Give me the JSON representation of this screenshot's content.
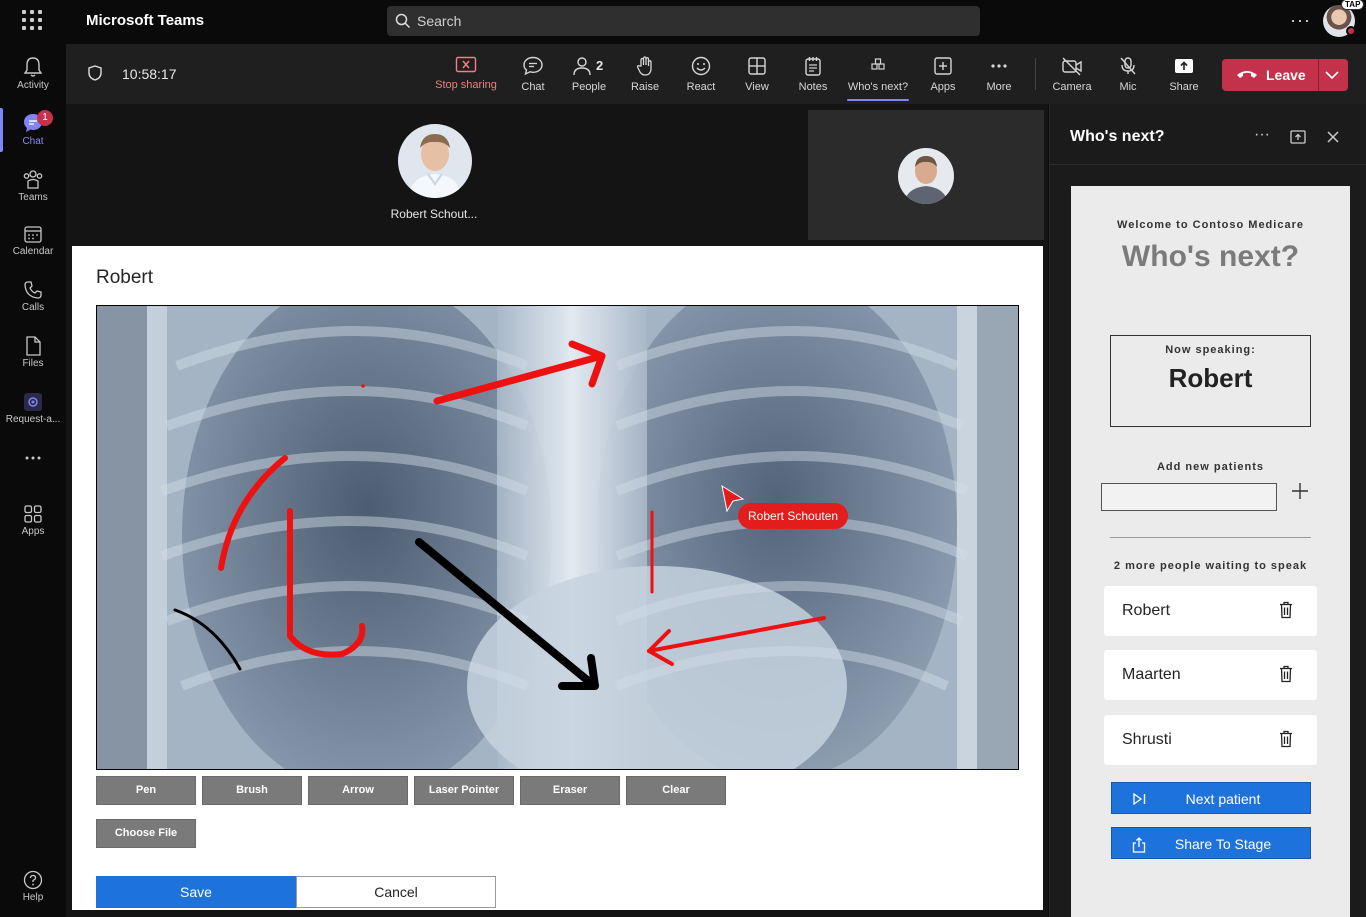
{
  "app": {
    "title": "Microsoft Teams"
  },
  "search": {
    "placeholder": "Search"
  },
  "user": {
    "initials_badge": "TAP"
  },
  "rail": {
    "items": [
      {
        "label": "Activity",
        "icon": "bell-icon"
      },
      {
        "label": "Chat",
        "icon": "chat-icon",
        "badge": "1",
        "active": true
      },
      {
        "label": "Teams",
        "icon": "teams-icon"
      },
      {
        "label": "Calendar",
        "icon": "calendar-icon"
      },
      {
        "label": "Calls",
        "icon": "phone-icon"
      },
      {
        "label": "Files",
        "icon": "file-icon"
      },
      {
        "label": "Request-a...",
        "icon": "app-icon"
      },
      {
        "label": "",
        "icon": "more-icon"
      },
      {
        "label": "Apps",
        "icon": "apps-icon"
      }
    ],
    "help_label": "Help"
  },
  "meeting": {
    "time": "10:58:17",
    "toolbar": {
      "stop_sharing": "Stop sharing",
      "chat": "Chat",
      "people": "People",
      "people_count": "2",
      "raise": "Raise",
      "react": "React",
      "view": "View",
      "notes": "Notes",
      "whos_next": "Who's next?",
      "apps": "Apps",
      "more": "More",
      "camera": "Camera",
      "mic": "Mic",
      "share": "Share",
      "leave": "Leave"
    },
    "participants": [
      {
        "name": "Robert Schout..."
      }
    ],
    "colors": {
      "leave": "#c4314b",
      "accent": "#7f85f5"
    }
  },
  "shared_content": {
    "title": "Robert",
    "tools": [
      "Pen",
      "Brush",
      "Arrow",
      "Laser Pointer",
      "Eraser",
      "Clear"
    ],
    "choose_file": "Choose File",
    "save": "Save",
    "cancel": "Cancel",
    "cursor_label": "Robert Schouten",
    "annotation_color": "#ee1111"
  },
  "panel": {
    "title": "Who's next?",
    "welcome": "Welcome to Contoso Medicare",
    "app_title": "Who's next?",
    "now_speaking_label": "Now speaking:",
    "now_speaking_name": "Robert",
    "add_label": "Add new patients",
    "add_input_value": "",
    "waiting_text": "2 more people waiting to speak",
    "queue": [
      "Robert",
      "Maarten",
      "Shrusti"
    ],
    "next_button": "Next patient",
    "share_button": "Share To Stage",
    "button_color": "#1d72db"
  }
}
